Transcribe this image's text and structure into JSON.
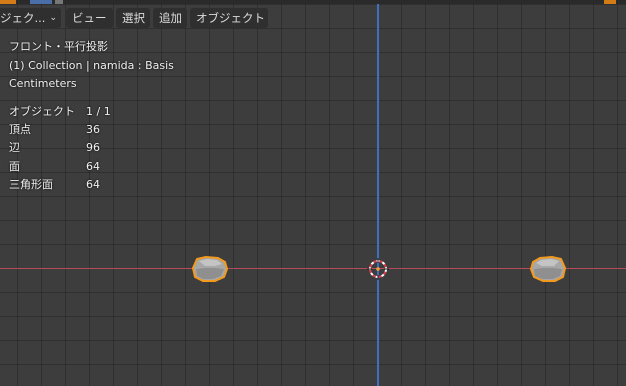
{
  "header": {
    "mode_label": "ジェク...",
    "menu": {
      "view": "ビュー",
      "select": "選択",
      "add": "追加",
      "object": "オブジェクト"
    }
  },
  "overlay": {
    "view_name": "フロント・平行投影",
    "collection": "(1) Collection | namida : Basis",
    "units": "Centimeters"
  },
  "stats": {
    "rows": [
      {
        "label": "オブジェクト",
        "value": "1 / 1"
      },
      {
        "label": "頂点",
        "value": "36"
      },
      {
        "label": "辺",
        "value": "96"
      },
      {
        "label": "面",
        "value": "64"
      },
      {
        "label": "三角形面",
        "value": "64"
      }
    ]
  },
  "colors": {
    "background": "#3d3d3d",
    "x_axis": "#b54a59",
    "z_axis": "#3f6fbf",
    "selection_outline": "#f29a1d",
    "object_fill": "#a4a4a4"
  }
}
